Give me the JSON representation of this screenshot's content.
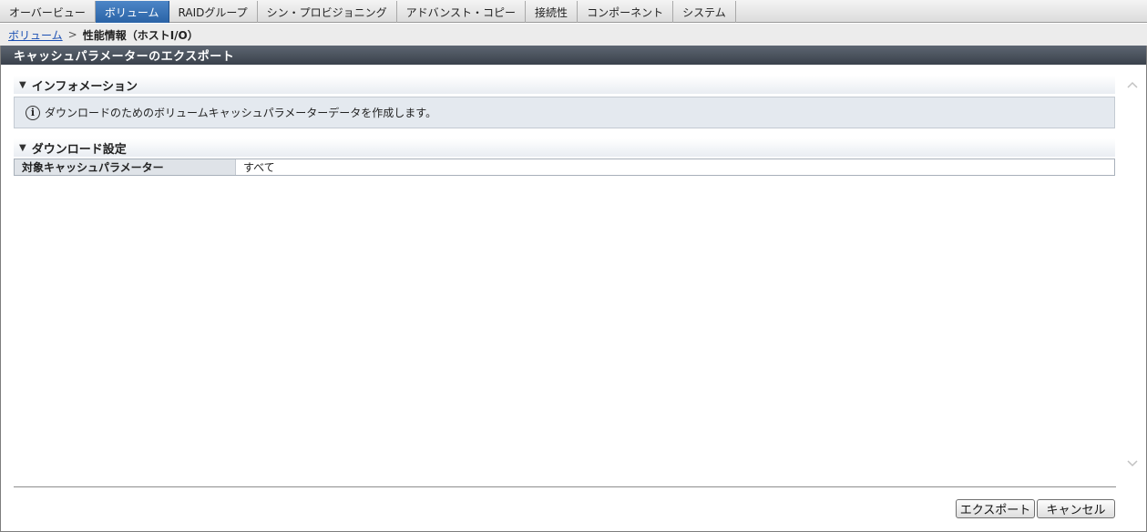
{
  "tabs": [
    {
      "label": "オーバービュー",
      "active": false
    },
    {
      "label": "ボリューム",
      "active": true
    },
    {
      "label": "RAIDグループ",
      "active": false
    },
    {
      "label": "シン・プロビジョニング",
      "active": false
    },
    {
      "label": "アドバンスト・コピー",
      "active": false
    },
    {
      "label": "接続性",
      "active": false
    },
    {
      "label": "コンポーネント",
      "active": false
    },
    {
      "label": "システム",
      "active": false
    }
  ],
  "breadcrumb": {
    "link": "ボリューム",
    "separator": ">",
    "current": "性能情報（ホストI/O）"
  },
  "dialog": {
    "title": "キャッシュパラメーターのエクスポート"
  },
  "information": {
    "heading": "インフォメーション",
    "message": "ダウンロードのためのボリュームキャッシュパラメーターデータを作成します。"
  },
  "download_settings": {
    "heading": "ダウンロード設定",
    "rows": [
      {
        "label": "対象キャッシュパラメーター",
        "value": "すべて"
      }
    ]
  },
  "buttons": {
    "export_label": "エクスポート",
    "cancel_label": "キャンセル"
  },
  "colors": {
    "active_tab": "#2a63a6",
    "title_bar": "#3a414b",
    "info_bg": "#e4e9ef",
    "link": "#1a4fb3"
  }
}
